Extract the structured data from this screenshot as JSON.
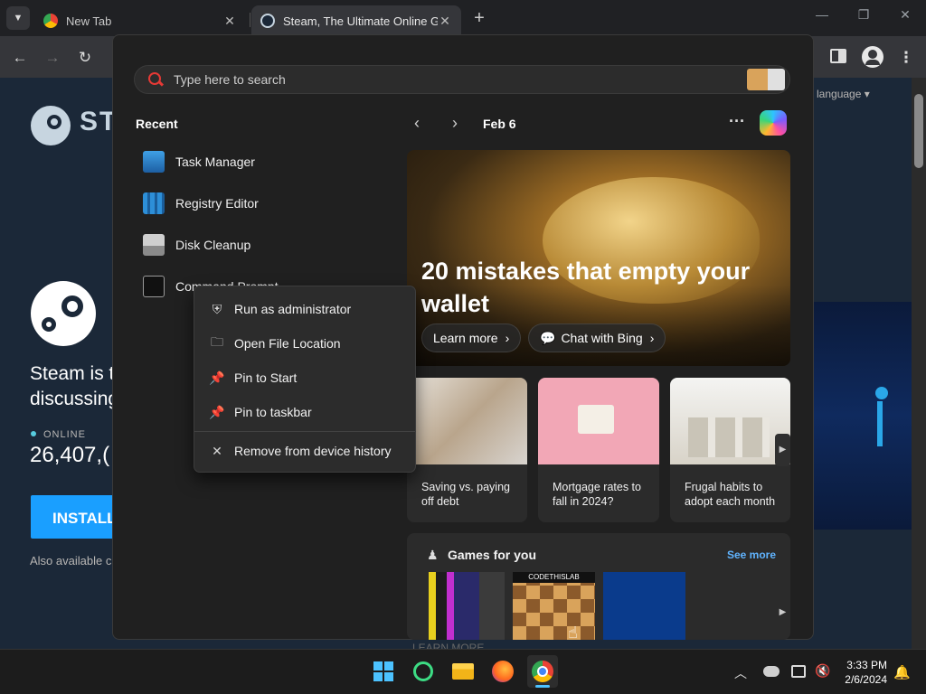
{
  "browser": {
    "tabs": [
      {
        "title": "New Tab"
      },
      {
        "title": "Steam, The Ultimate Online Gar"
      }
    ],
    "icons": {
      "tab_menu": "chevron-down-icon",
      "new_tab": "plus-icon",
      "back": "back-arrow-icon",
      "forward": "forward-arrow-icon",
      "reload": "reload-icon",
      "side_panel": "side-panel-icon",
      "profile": "profile-icon",
      "menu": "kebab-menu-icon"
    }
  },
  "steam_page": {
    "brand": "STI",
    "language": "language",
    "tagline_line1": "Steam is t",
    "tagline_line2": "discussing",
    "online_label": "ONLINE",
    "online_count": "26,407,(",
    "install_label": "INSTALL",
    "also_available": "Also available c",
    "colors": {
      "bg": "#1b2838",
      "install": "#1a9fff"
    }
  },
  "start_menu": {
    "search_placeholder": "Type here to search",
    "recent_title": "Recent",
    "recent_items": [
      {
        "label": "Task Manager",
        "icon": "task-manager-icon"
      },
      {
        "label": "Registry Editor",
        "icon": "registry-editor-icon"
      },
      {
        "label": "Disk Cleanup",
        "icon": "disk-cleanup-icon"
      },
      {
        "label": "Command Prompt",
        "icon": "command-prompt-icon"
      }
    ],
    "context_menu": [
      {
        "label": "Run as administrator",
        "icon": "shield-icon"
      },
      {
        "label": "Open File Location",
        "icon": "folder-icon"
      },
      {
        "label": "Pin to Start",
        "icon": "pin-icon"
      },
      {
        "label": "Pin to taskbar",
        "icon": "pin-icon"
      },
      {
        "label": "Remove from device history",
        "icon": "close-icon"
      }
    ],
    "widgets": {
      "date": "Feb 6",
      "hero": {
        "title": "20 mistakes that empty your wallet",
        "learn_more": "Learn more",
        "chat_bing": "Chat with Bing"
      },
      "news": [
        {
          "title": "Saving vs. paying off debt"
        },
        {
          "title": "Mortgage rates to fall in 2024?"
        },
        {
          "title": "Frugal habits to adopt each month"
        }
      ],
      "games_title": "Games for you",
      "see_more": "See more",
      "game_badge": "CODETHISLAB",
      "footer_partial": "LEARN MORE"
    }
  },
  "taskbar": {
    "time": "3:33 PM",
    "date": "2/6/2024",
    "apps": [
      "windows-start-icon",
      "search-app-icon",
      "file-explorer-icon",
      "firefox-icon",
      "chrome-icon"
    ],
    "tray": [
      "chevron-up-icon",
      "onedrive-icon",
      "network-icon",
      "volume-muted-icon",
      "notification-bell-icon"
    ]
  }
}
